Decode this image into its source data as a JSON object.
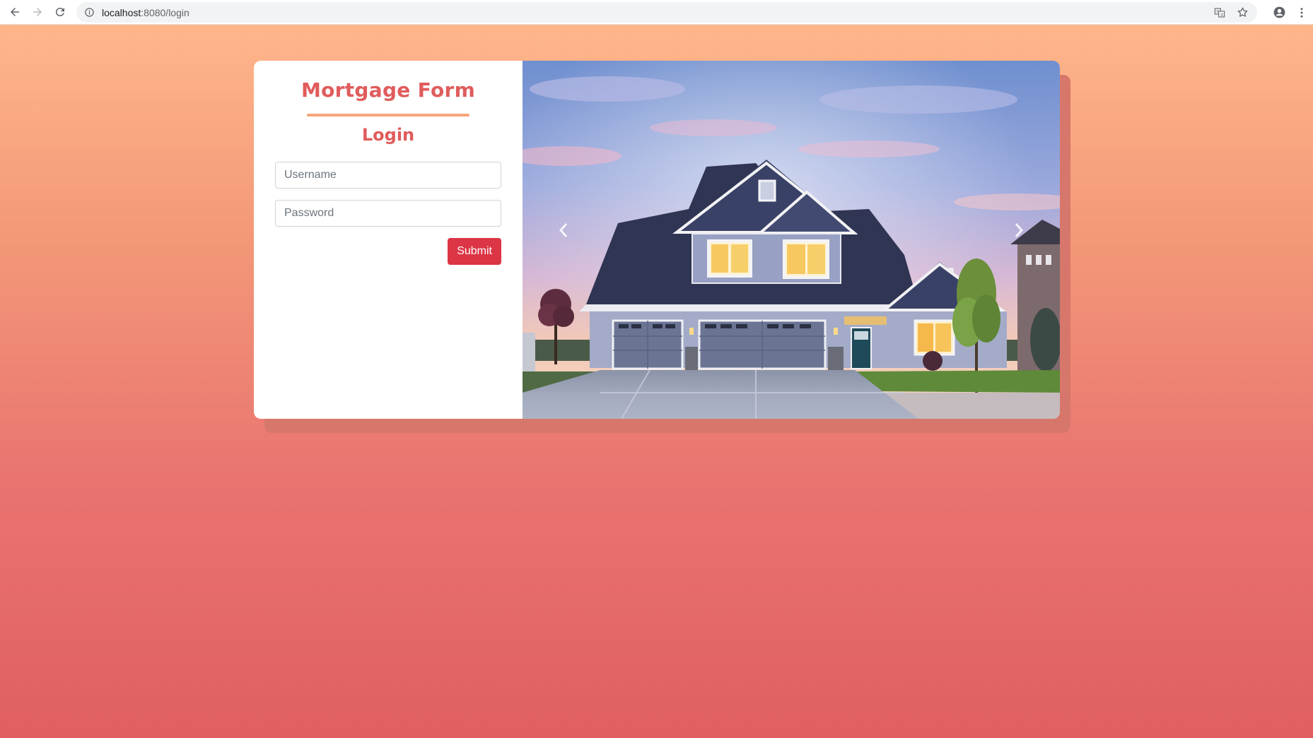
{
  "browser": {
    "url_host": "localhost",
    "url_rest": ":8080/login",
    "icons": [
      "back-icon",
      "forward-icon",
      "reload-icon",
      "info-icon",
      "translate-icon",
      "star-icon",
      "account-icon",
      "menu-icon"
    ]
  },
  "form": {
    "brand_title": "Mortgage Form",
    "section_title": "Login",
    "username_placeholder": "Username",
    "password_placeholder": "Password",
    "submit_label": "Submit"
  },
  "carousel": {
    "image_subject": "house",
    "prev_icon": "chevron-left-icon",
    "next_icon": "chevron-right-icon"
  },
  "colors": {
    "accent": "#e05c5c",
    "rule": "#f6a57a",
    "button": "#dc3545",
    "bg_top": "#ffb68b",
    "bg_bottom": "#e05f62"
  }
}
